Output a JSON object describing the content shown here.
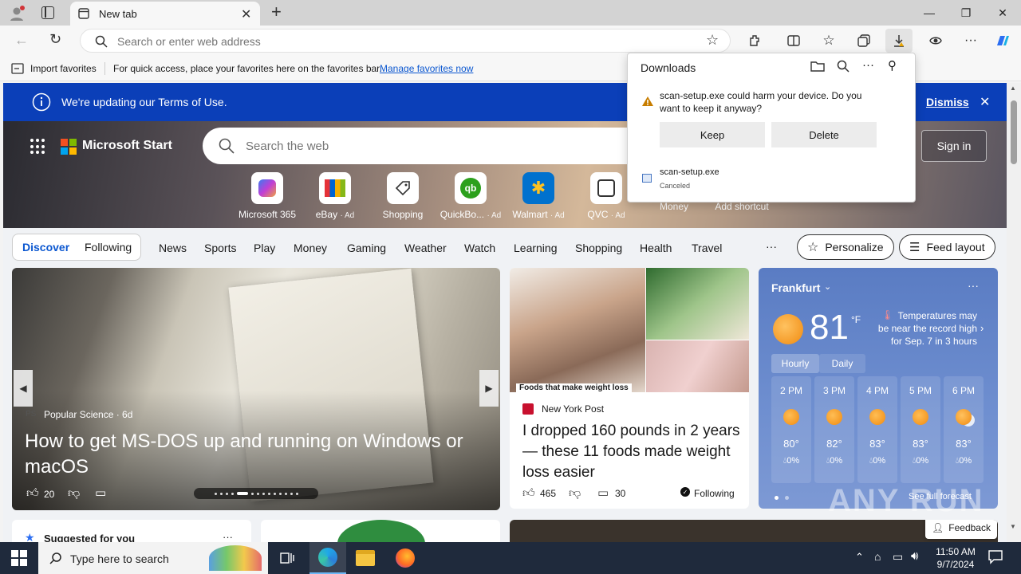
{
  "browser": {
    "tab_title": "New tab",
    "address_placeholder": "Search or enter web address"
  },
  "favorites_bar": {
    "import_label": "Import favorites",
    "hint": "For quick access, place your favorites here on the favorites bar.",
    "manage_link": "Manage favorites now"
  },
  "downloads": {
    "title": "Downloads",
    "warning": "scan-setup.exe could harm your device. Do you want to keep it anyway?",
    "keep_label": "Keep",
    "delete_label": "Delete",
    "file_name": "scan-setup.exe",
    "file_status": "Canceled"
  },
  "terms_banner": {
    "text": "We're updating our Terms of Use.",
    "dismiss_label": "Dismiss"
  },
  "start": {
    "brand": "Microsoft Start",
    "search_placeholder": "Search the web",
    "sign_in": "Sign in",
    "quick_links": [
      {
        "label": "Microsoft 365",
        "ad": ""
      },
      {
        "label": "eBay",
        "ad": "· Ad"
      },
      {
        "label": "Shopping",
        "ad": ""
      },
      {
        "label": "QuickBo...",
        "ad": "· Ad"
      },
      {
        "label": "Walmart",
        "ad": "· Ad"
      },
      {
        "label": "QVC",
        "ad": "· Ad"
      },
      {
        "label": "Money",
        "ad": ""
      },
      {
        "label": "Add shortcut",
        "ad": ""
      }
    ]
  },
  "feed_nav": {
    "discover": "Discover",
    "following": "Following",
    "items": [
      "News",
      "Sports",
      "Play",
      "Money",
      "Gaming",
      "Weather",
      "Watch",
      "Learning",
      "Shopping",
      "Health",
      "Travel"
    ],
    "more": "···",
    "personalize": "Personalize",
    "feed_layout": "Feed layout"
  },
  "main_card": {
    "source": "Popular Science · 6d",
    "source_icon": "PS",
    "headline": "How to get MS-DOS up and running on Windows or macOS",
    "likes": "20"
  },
  "nyp_card": {
    "image_caption": "Foods that make weight loss",
    "source": "New York Post",
    "headline": "I dropped 160 pounds in 2 years — these 11 foods made weight loss easier",
    "likes": "465",
    "comments": "30",
    "following": "Following"
  },
  "weather": {
    "city": "Frankfurt",
    "temp": "81",
    "unit": "°F",
    "alert": "Temperatures may be near the record high for Sep. 7 in 3 hours",
    "tab_hourly": "Hourly",
    "tab_daily": "Daily",
    "hours": [
      {
        "time": "2 PM",
        "temp": "80°",
        "precip": "0%",
        "icon": "sun-icon"
      },
      {
        "time": "3 PM",
        "temp": "82°",
        "precip": "0%",
        "icon": "sun-icon"
      },
      {
        "time": "4 PM",
        "temp": "83°",
        "precip": "0%",
        "icon": "sun-icon"
      },
      {
        "time": "5 PM",
        "temp": "83°",
        "precip": "0%",
        "icon": "sun-icon"
      },
      {
        "time": "6 PM",
        "temp": "83°",
        "precip": "0%",
        "icon": "partly-cloudy-icon"
      }
    ],
    "forecast_link": "See full forecast"
  },
  "below": {
    "suggested": "Suggested for you",
    "feedback": "Feedback"
  },
  "watermark": "ANY RUN",
  "taskbar": {
    "search_placeholder": "Type here to search",
    "time": "11:50 AM",
    "date": "9/7/2024"
  },
  "colors": {
    "accent": "#0b3fb8",
    "link": "#0b57d0",
    "warning": "#c77d00"
  }
}
